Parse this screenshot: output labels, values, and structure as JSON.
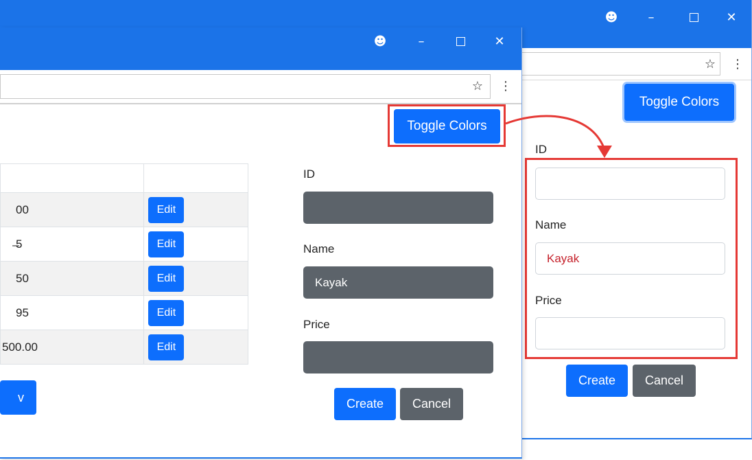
{
  "back_window": {
    "form": {
      "toggle_label": "Toggle Colors",
      "fields": [
        {
          "label": "ID",
          "value": ""
        },
        {
          "label": "Name",
          "value": "Kayak"
        },
        {
          "label": "Price",
          "value": ""
        }
      ],
      "create_label": "Create",
      "cancel_label": "Cancel"
    }
  },
  "front_window": {
    "toggle_label": "Toggle Colors",
    "table": {
      "rows": [
        {
          "price": "00",
          "edit_label": "Edit"
        },
        {
          "price": "̶5",
          "edit_label": "Edit"
        },
        {
          "price": "50",
          "edit_label": "Edit"
        },
        {
          "price": "95",
          "edit_label": "Edit"
        },
        {
          "price": "500.00",
          "edit_label": "Edit"
        }
      ]
    },
    "new_button_label": "v",
    "form": {
      "fields": [
        {
          "label": "ID",
          "value": ""
        },
        {
          "label": "Name",
          "value": "Kayak"
        },
        {
          "label": "Price",
          "value": ""
        }
      ],
      "create_label": "Create",
      "cancel_label": "Cancel"
    }
  },
  "icons": {
    "account": "account-circle-icon",
    "minimize": "minimize-icon",
    "maximize": "maximize-icon",
    "close": "close-icon",
    "bookmark": "star-icon",
    "menu": "kebab-menu-icon"
  },
  "colors": {
    "titlebar": "#1b73e8",
    "primary": "#0d6efd",
    "secondary": "#5c636a",
    "highlight": "#e53935",
    "invalid_text": "#c5212b"
  }
}
